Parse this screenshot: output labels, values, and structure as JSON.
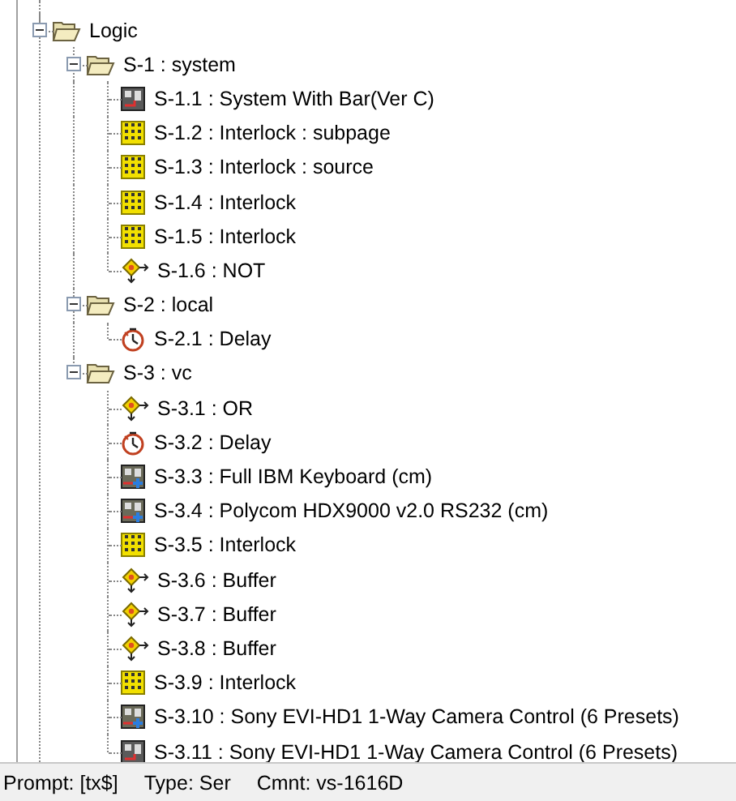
{
  "tree": [
    {
      "label": "Logic",
      "kind": "folder",
      "expanded": true,
      "children": [
        {
          "label": "S-1 : system",
          "kind": "folder",
          "expanded": true,
          "children": [
            {
              "label": "S-1.1 : System With Bar(Ver C)",
              "kind": "system"
            },
            {
              "label": "S-1.2 : Interlock : subpage",
              "kind": "interlock"
            },
            {
              "label": "S-1.3 : Interlock : source",
              "kind": "interlock"
            },
            {
              "label": "S-1.4 : Interlock",
              "kind": "interlock"
            },
            {
              "label": "S-1.5 : Interlock",
              "kind": "interlock"
            },
            {
              "label": "S-1.6 : NOT",
              "kind": "logic"
            }
          ]
        },
        {
          "label": "S-2 : local",
          "kind": "folder",
          "expanded": true,
          "children": [
            {
              "label": "S-2.1 : Delay",
              "kind": "delay"
            }
          ]
        },
        {
          "label": "S-3 : vc",
          "kind": "folder",
          "expanded": true,
          "children": [
            {
              "label": "S-3.1 : OR",
              "kind": "logic"
            },
            {
              "label": "S-3.2 : Delay",
              "kind": "delay"
            },
            {
              "label": "S-3.3 : Full IBM Keyboard (cm)",
              "kind": "device"
            },
            {
              "label": "S-3.4 : Polycom HDX9000 v2.0 RS232 (cm)",
              "kind": "device"
            },
            {
              "label": "S-3.5 : Interlock",
              "kind": "interlock"
            },
            {
              "label": "S-3.6 : Buffer",
              "kind": "logic"
            },
            {
              "label": "S-3.7 : Buffer",
              "kind": "logic"
            },
            {
              "label": "S-3.8 : Buffer",
              "kind": "logic"
            },
            {
              "label": "S-3.9 : Interlock",
              "kind": "interlock"
            },
            {
              "label": "S-3.10 : Sony EVI-HD1 1-Way Camera Control (6 Presets)",
              "kind": "device"
            },
            {
              "label": "S-3.11 : Sony EVI-HD1 1-Way Camera Control (6 Presets)",
              "kind": "system"
            }
          ]
        }
      ]
    }
  ],
  "status_bar": [
    "Prompt: [tx$]",
    "Type: Ser",
    "Cmnt: vs-1616D"
  ]
}
